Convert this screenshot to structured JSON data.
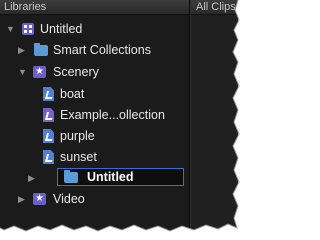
{
  "header": {
    "title": "Libraries",
    "right_title": "All Clips"
  },
  "tree": {
    "library": {
      "label": "Untitled"
    },
    "smart_collections": {
      "label": "Smart Collections"
    },
    "event_scenery": {
      "label": "Scenery"
    },
    "items": [
      {
        "label": "boat"
      },
      {
        "label": "Example...ollection"
      },
      {
        "label": "purple"
      },
      {
        "label": "sunset"
      }
    ],
    "new_folder": {
      "label": "Untitled"
    },
    "event_video": {
      "label": "Video"
    }
  },
  "colors": {
    "accent": "#3a6cd0",
    "library_icon": "#6b5fc9",
    "folder_icon": "#5b9bd6"
  },
  "icons": [
    "disclosure-triangle",
    "library-icon",
    "folder-icon",
    "event-star-icon",
    "keyword-collection-icon",
    "smart-collection-icon"
  ]
}
